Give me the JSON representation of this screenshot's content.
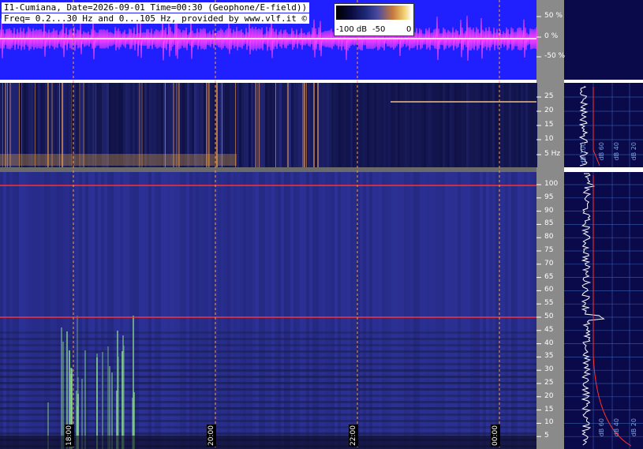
{
  "header": {
    "line1": "I1-Cumiana, Date=2026-09-01 Time=00:30 (Geophone/E-field))",
    "line2": "Freq= 0.2...30 Hz and 0...105 Hz, provided by www.vlf.it ©"
  },
  "colorbar": {
    "labels": [
      "-100 dB",
      "-50",
      "0"
    ]
  },
  "waveform_axis": [
    "50 %",
    "0 %",
    "-50 %"
  ],
  "upper_freq_axis": [
    "25",
    "20",
    "15",
    "10",
    "5 Hz"
  ],
  "lower_freq_axis": [
    "100",
    "95",
    "90",
    "85",
    "80",
    "75",
    "70",
    "65",
    "60",
    "55",
    "50",
    "45",
    "40",
    "35",
    "30",
    "25",
    "20",
    "15",
    "10",
    "5"
  ],
  "time_labels": [
    "18:00",
    "20:00",
    "22:00",
    "00:00"
  ],
  "side_panel": {
    "upper_units": [
      "dB 100",
      "dB 60",
      "dB 40",
      "dB 20"
    ],
    "lower_units": [
      "dB 60",
      "dB 40",
      "dB 20"
    ]
  },
  "colors": {
    "waveform_bg": "#2020ff",
    "waveform_trace": "#ff40ff",
    "spectrogram_bg": "#2a2f80",
    "side_bg": "#0a0a4a",
    "axis_bg": "#8a8a8a",
    "line_50hz": "#ff3030",
    "grid_dash": "#f0a060"
  }
}
